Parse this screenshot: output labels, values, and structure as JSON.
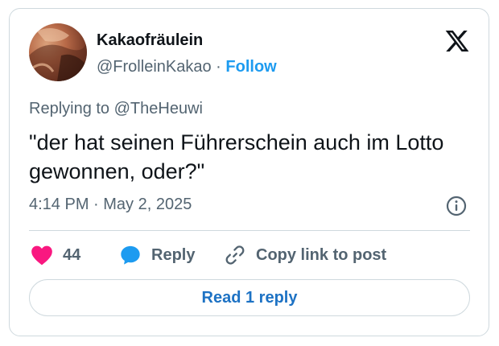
{
  "author": {
    "display_name": "Kakaofräulein",
    "handle": "@FrolleinKakao",
    "separator": "·",
    "follow_label": "Follow",
    "avatar_icon": "profile-photo"
  },
  "brand": {
    "logo_icon": "x-logo-icon"
  },
  "tweet": {
    "replying_to": "Replying to @TheHeuwi",
    "text": "\"der hat seinen Führerschein auch im Lotto gewonnen, oder?\"",
    "timestamp": "4:14 PM · May 2, 2025"
  },
  "actions": {
    "like_count": "44",
    "reply_label": "Reply",
    "copy_label": "Copy link to post"
  },
  "footer": {
    "read_replies_label": "Read 1 reply"
  },
  "colors": {
    "accent": "#1d9bf0",
    "link_button_text": "#1d72c4",
    "like": "#f91880",
    "text_primary": "#0f1419",
    "text_secondary": "#536471",
    "border": "#cfd9de"
  }
}
